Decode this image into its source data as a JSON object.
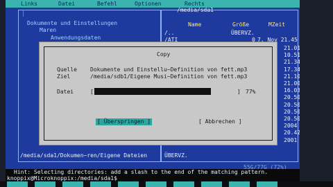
{
  "menubar": {
    "items": [
      "Links",
      "Datei",
      "Befehl",
      "Optionen",
      "Rechts"
    ]
  },
  "left_panel": {
    "tree": [
      "Dokumente und Einstellungen",
      "Maren",
      "Anwendungsdaten"
    ],
    "path": "/media/sda1/Dokumen~ren/Eigene Dateien"
  },
  "right_panel": {
    "title": "/media/sda1",
    "headers": {
      "name": "Name",
      "size": "Größe",
      "mtime": "MZeit"
    },
    "rows": [
      {
        "name": "/..",
        "size": "ÜBERVZ.",
        "mtime": ""
      },
      {
        "name": "/ATI",
        "size": "0",
        "mtime": "7. Nov 21.45"
      }
    ],
    "times_col": [
      "21.01",
      "10.51",
      "21.34",
      "17.34",
      "21.10",
      "21.00",
      "16.03",
      "20.50",
      "20.50",
      "20.50",
      "20.50",
      "2004",
      "20.42",
      "2001"
    ],
    "status_name": "ÜBERVZ.",
    "free_space": "55G/77G (72%)"
  },
  "dialog": {
    "title": "Copy",
    "source_label": "Quelle",
    "source_value": "Dokumente und Einstellu~Definition von fett.mp3",
    "target_label": "Ziel",
    "target_value": "/media/sdb1/Eigene Musi~Definition von fett.mp3",
    "file_label": "Datei",
    "progress_open": "[",
    "progress_close": "]",
    "progress_percent": "77%",
    "progress_fraction": 0.77,
    "skip_button": "[ Überspringen ]",
    "cancel_button": "[ Abbrechen ]"
  },
  "hint": "Hint: Selecting directories: add a slash to the end of the matching pattern.",
  "prompt": "knoppix@Microknoppix:/media/sda1$",
  "colors": {
    "panel_bg": "#1f3a9e",
    "accent_cyan": "#3bb4b0",
    "highlight_yellow": "#ffe86a",
    "dialog_bg": "#c8c8c8"
  }
}
